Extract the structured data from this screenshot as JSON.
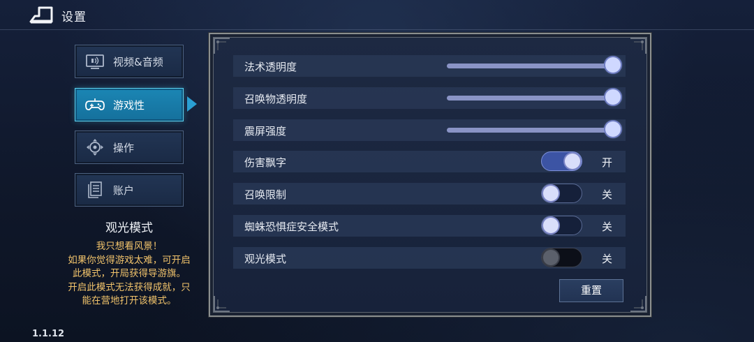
{
  "header": {
    "title": "设置",
    "back_icon": "back-arrow-icon"
  },
  "nav": {
    "items": [
      {
        "label": "视频&音频",
        "icon": "display-sound-icon",
        "active": false
      },
      {
        "label": "游戏性",
        "icon": "gamepad-icon",
        "active": true
      },
      {
        "label": "操作",
        "icon": "dpad-icon",
        "active": false
      },
      {
        "label": "账户",
        "icon": "document-icon",
        "active": false
      }
    ]
  },
  "info": {
    "title": "观光模式",
    "lines": [
      "我只想看风景！",
      "如果你觉得游戏太难，可开启",
      "此模式，开局获得导游旗。",
      "开启此模式无法获得成就，只",
      "能在营地打开该模式。"
    ]
  },
  "version": "1.1.12",
  "settings": {
    "sliders": [
      {
        "label": "法术透明度",
        "value_fraction": 1.0
      },
      {
        "label": "召唤物透明度",
        "value_fraction": 1.0
      },
      {
        "label": "震屏强度",
        "value_fraction": 1.0
      }
    ],
    "toggles": [
      {
        "label": "伤害飘字",
        "on": true,
        "enabled": true,
        "state_label": "开"
      },
      {
        "label": "召唤限制",
        "on": false,
        "enabled": true,
        "state_label": "关"
      },
      {
        "label": "蜘蛛恐惧症安全模式",
        "on": false,
        "enabled": true,
        "state_label": "关"
      },
      {
        "label": "观光模式",
        "on": false,
        "enabled": false,
        "state_label": "关"
      }
    ],
    "reset_label": "重置"
  },
  "colors": {
    "accent": "#1b86b4",
    "tip_text": "#f1c36b",
    "slider_fill": "#8a94c6",
    "toggle_on": "#3c54a4"
  }
}
